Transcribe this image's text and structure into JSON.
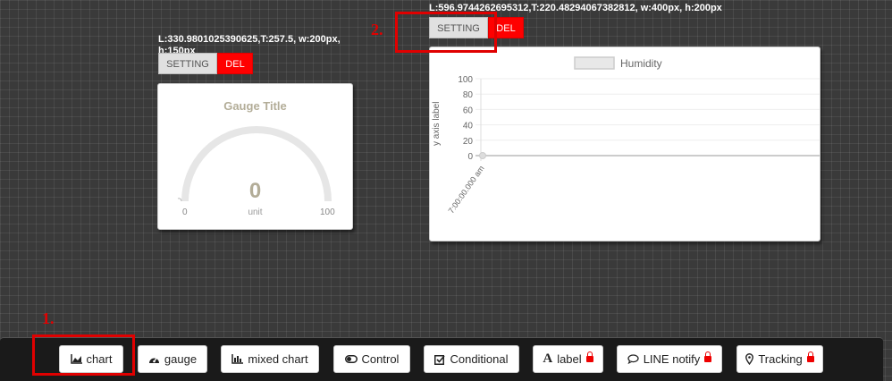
{
  "gauge_widget": {
    "info_line1": "L:330.9801025390625,T:257.5, w:200px,",
    "info_line2": "h:150px",
    "setting_label": "SETTING",
    "del_label": "DEL",
    "title": "Gauge Title",
    "value": "0",
    "unit": "unit",
    "min": "0",
    "max": "100"
  },
  "chart_widget": {
    "info": "L:596.9744262695312,T:220.48294067382812, w:400px, h:200px",
    "setting_label": "SETTING",
    "del_label": "DEL"
  },
  "chart_data": {
    "type": "line",
    "legend": [
      "Humidity"
    ],
    "legend_position": "top",
    "ylabel": "y axis label",
    "yticks": [
      "100",
      "80",
      "60",
      "40",
      "20",
      "0"
    ],
    "ylim": [
      0,
      100
    ],
    "categories": [
      "7:00:00.000 am"
    ],
    "series": [
      {
        "name": "Humidity",
        "values": [
          0
        ]
      }
    ],
    "grid": true
  },
  "annotations": {
    "one": "1.",
    "two": "2."
  },
  "toolbar": {
    "chart": "chart",
    "gauge": "gauge",
    "mixed_chart": "mixed chart",
    "control": "Control",
    "conditional": "Conditional",
    "label": "label",
    "line_notify": "LINE notify",
    "tracking": "Tracking"
  },
  "colors": {
    "del": "#ff0000",
    "annotation": "#e00000"
  }
}
